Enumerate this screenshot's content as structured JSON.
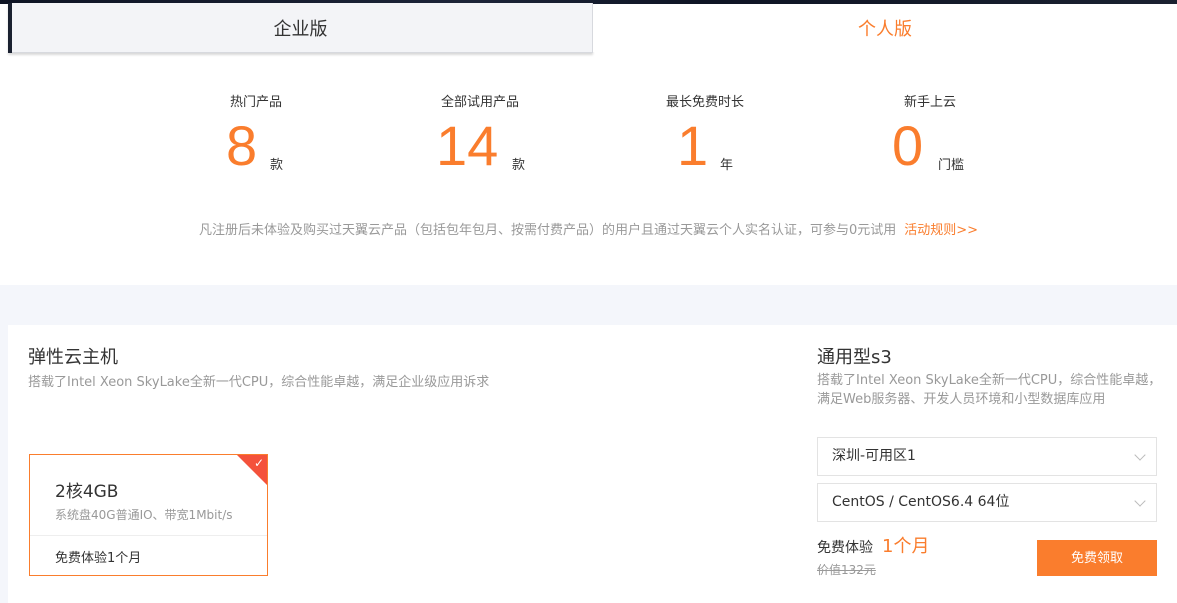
{
  "tabs": {
    "enterprise": "企业版",
    "personal": "个人版"
  },
  "stats": [
    {
      "label": "热门产品",
      "value": "8",
      "unit": "款"
    },
    {
      "label": "全部试用产品",
      "value": "14",
      "unit": "款"
    },
    {
      "label": "最长免费时长",
      "value": "1",
      "unit": "年"
    },
    {
      "label": "新手上云",
      "value": "0",
      "unit": "门槛"
    }
  ],
  "notice": {
    "text": "凡注册后未体验及购买过天翼云产品（包括包年包月、按需付费产品）的用户且通过天翼云个人实名认证，可参与0元试用",
    "link": "活动规则>>"
  },
  "product": {
    "title": "弹性云主机",
    "desc": "搭载了Intel Xeon SkyLake全新一代CPU，综合性能卓越，满足企业级应用诉求",
    "spec": {
      "name": "2核4GB",
      "detail": "系统盘40G普通IO、带宽1Mbit/s",
      "trial": "免费体验1个月",
      "check": "✓"
    }
  },
  "config": {
    "title": "通用型s3",
    "desc": "搭载了Intel Xeon SkyLake全新一代CPU，综合性能卓越，满足Web服务器、开发人员环境和小型数据库应用",
    "region": "深圳-可用区1",
    "os": "CentOS / CentOS6.4 64位",
    "price_label": "免费体验",
    "price_value": "1个月",
    "orig_price": "价值132元",
    "claim_button": "免费领取"
  },
  "colors": {
    "accent": "#fa7d2d",
    "corner": "#f4523b"
  }
}
